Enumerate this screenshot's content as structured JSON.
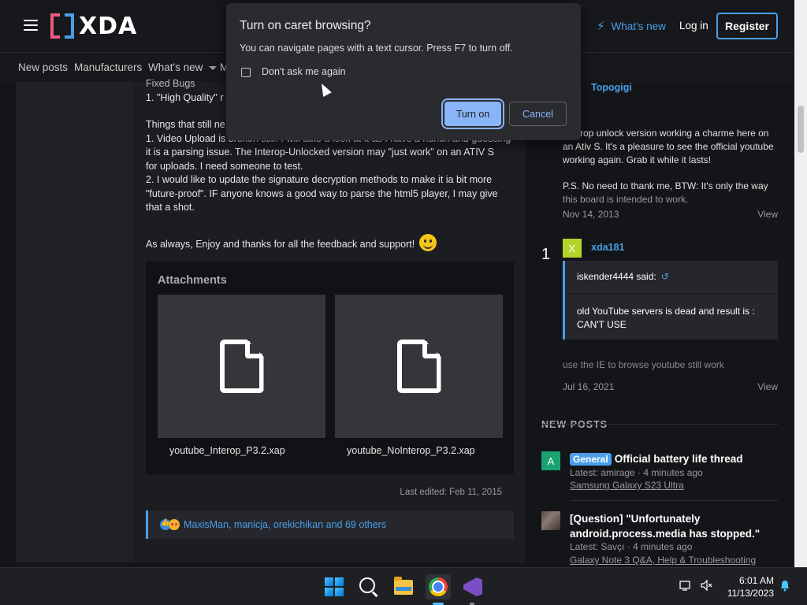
{
  "header": {
    "logo_text": "XDA",
    "whats_new": "What's new",
    "login": "Log in",
    "register": "Register"
  },
  "nav": {
    "items": [
      "New posts",
      "Manufacturers",
      "What's new",
      "M"
    ]
  },
  "post": {
    "partial_heading": "Fixed Bugs",
    "line_high_quality": "1. \"High Quality\" r",
    "things_broken": "Things that still ne",
    "line_video_upload_a": "1. Video Upload is broken still. I will take a look at it as I have a hunch and guessing",
    "line_video_upload_b": "it is a parsing issue. The Interop-Unlocked version may \"just work\" on an ATIV S",
    "line_video_upload_c": "for uploads. I need someone to test.",
    "line_signature_a": "2. I would like to update the signature decryption methods to make it ia bit more",
    "line_signature_b": "\"future-proof\". IF anyone knows a good way to parse the html5 player, I may give",
    "line_signature_c": "that a shot.",
    "closing": "As always, Enjoy and thanks for all the feedback and support!",
    "attachments_title": "Attachments",
    "attachments": [
      {
        "name": "youtube_Interop_P3.2.xap"
      },
      {
        "name": "youtube_NoInterop_P3.2.xap"
      }
    ],
    "last_edited": "Last edited: Feb 11, 2015",
    "reactions": "MaxisMan, manicja, orekichikan and 69 others"
  },
  "sidebar": {
    "post1": {
      "user": "Topogigi",
      "heading": "nt!",
      "text_a": "rop unlock version working a charme here on",
      "text_b": "an Ativ S. It's a pleasure to see the official youtube",
      "text_c": "working again. Grab it while it lasts!",
      "text_d": "P.S. No need to thank me, BTW: It's only the way",
      "text_e": "this board is intended to work.",
      "date": "Nov 14, 2013",
      "view": "View"
    },
    "post2": {
      "rank": "1",
      "avatar_letter": "X",
      "user": "xda181",
      "quote_author": "iskender4444 said:",
      "quote_line1": "old YouTube servers is dead and result is :",
      "quote_line2": "CAN'T USE",
      "text": "use the IE to browse youtube still work",
      "date": "Jul 16, 2021",
      "view": "View"
    },
    "new_posts_heading": "NEW POSTS",
    "new_posts": [
      {
        "avatar_letter": "A",
        "badge": "General",
        "title": "Official battery life thread",
        "meta": "Latest: amirage · 4 minutes ago",
        "forum": "Samsung Galaxy S23 Ultra"
      },
      {
        "title_line1": "[Question] \"Unfortunately",
        "title_line2": "android.process.media has stopped.\"",
        "meta": "Latest: Savçı · 4 minutes ago",
        "forum": "Galaxy Note 3 Q&A, Help & Troubleshooting"
      }
    ]
  },
  "dialog": {
    "title": "Turn on caret browsing?",
    "message": "You can navigate pages with a text cursor. Press F7 to turn off.",
    "checkbox_label": "Don't ask me again",
    "turn_on": "Turn on",
    "cancel": "Cancel"
  },
  "taskbar": {
    "time": "6:01 AM",
    "date": "11/13/2023",
    "icons": [
      "windows-start-icon",
      "search-icon",
      "file-explorer-icon",
      "chrome-icon",
      "visual-studio-icon"
    ]
  },
  "colors": {
    "accent": "#4a9fe8",
    "dialog_primary": "#8ab4f8",
    "logo_pink": "#f05a7e"
  }
}
